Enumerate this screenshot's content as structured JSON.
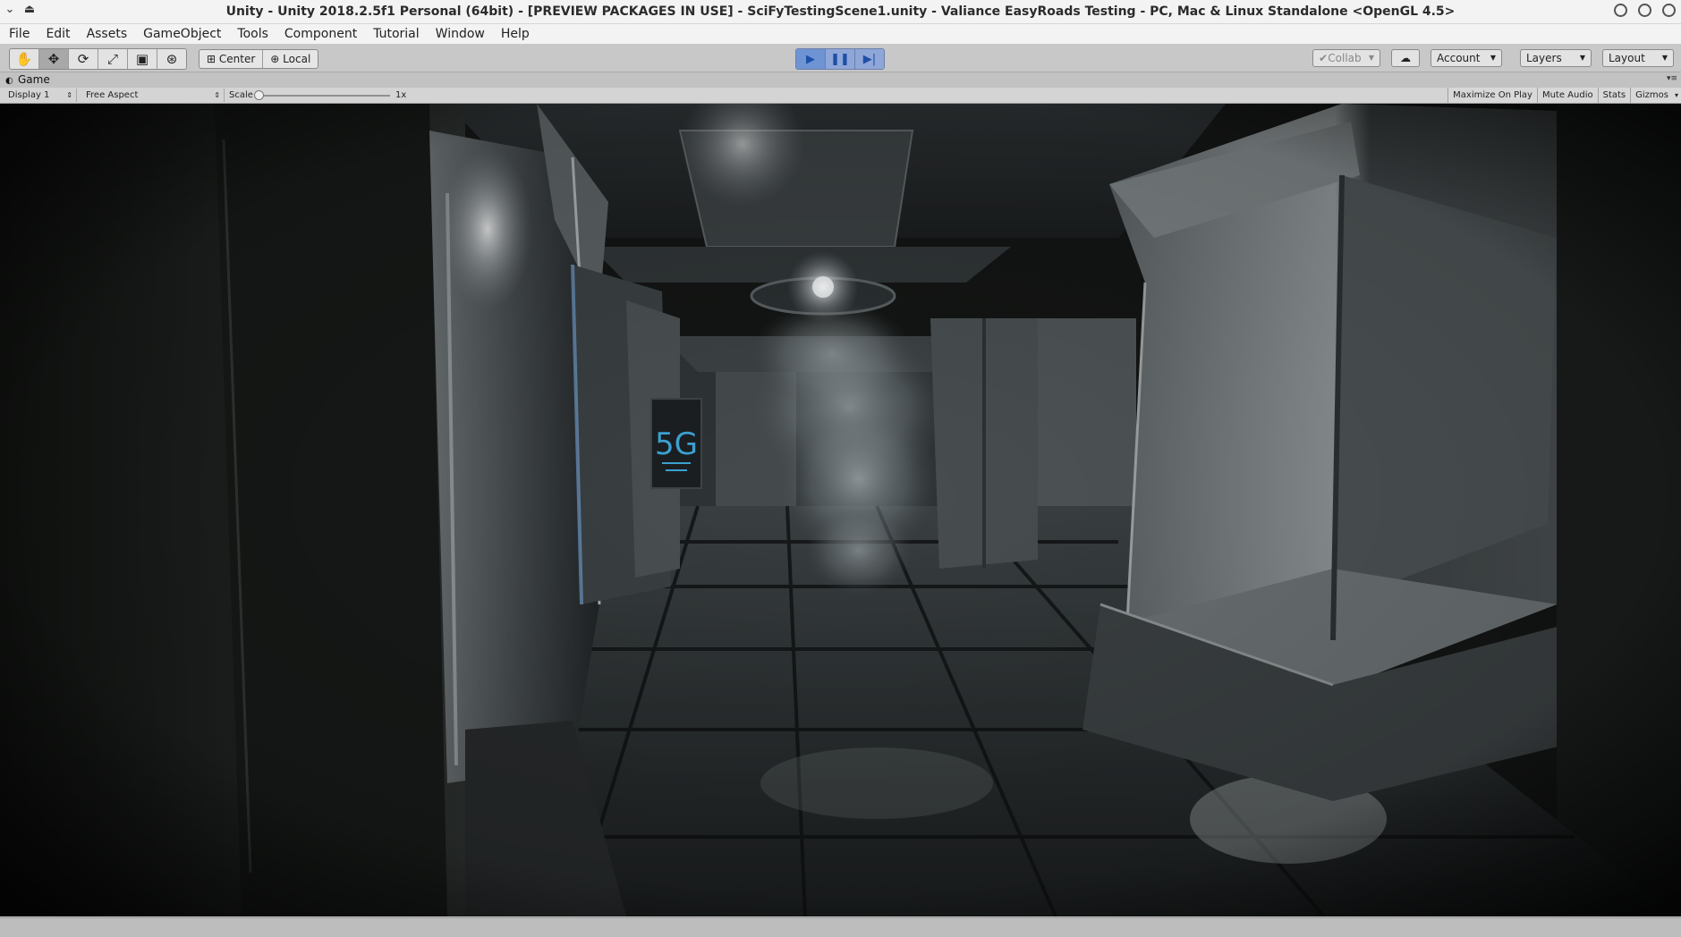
{
  "window": {
    "title": "Unity - Unity 2018.2.5f1 Personal (64bit) - [PREVIEW PACKAGES IN USE] - SciFyTestingScene1.unity - Valiance EasyRoads Testing - PC, Mac & Linux Standalone <OpenGL 4.5>"
  },
  "menu": [
    "File",
    "Edit",
    "Assets",
    "GameObject",
    "Tools",
    "Component",
    "Tutorial",
    "Window",
    "Help"
  ],
  "toolbar": {
    "tools": [
      "hand-tool-icon",
      "move-tool-icon",
      "rotate-tool-icon",
      "scale-tool-icon",
      "rect-tool-icon",
      "transform-tool-icon"
    ],
    "pivot_mode": "Center",
    "pivot_rotation": "Local",
    "collab": "Collab",
    "account": "Account",
    "layers": "Layers",
    "layout": "Layout"
  },
  "game_tab": {
    "label": "Game"
  },
  "game_toolbar": {
    "display": "Display 1",
    "aspect": "Free Aspect",
    "scale_label": "Scale",
    "scale_value": "1x",
    "maximize": "Maximize On Play",
    "mute": "Mute Audio",
    "stats": "Stats",
    "gizmos": "Gizmos"
  },
  "scene": {
    "sign_text": "5G"
  },
  "colors": {
    "play_active": "#6f94d4",
    "editor_gray": "#c2c2c2",
    "scene_dark": "#0e0f0d",
    "sign_cyan": "#3ea6d8"
  }
}
